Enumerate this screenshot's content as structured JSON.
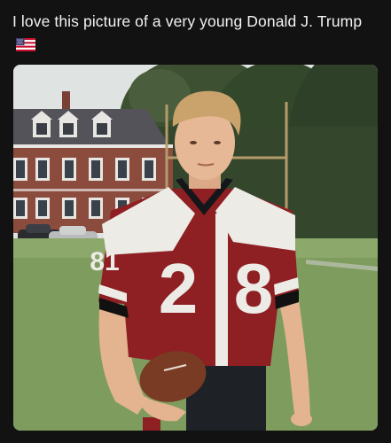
{
  "post": {
    "caption": "I love this picture of a very young Donald J. Trump",
    "caption_emoji": "us-flag-icon"
  },
  "photo": {
    "jersey_number": "28",
    "sleeve_number": "81",
    "colors": {
      "jersey_red": "#8e1f22",
      "jersey_white": "#ecebe6",
      "grass": "#7e9c5e",
      "sky": "#dfe3e2",
      "trees": "#35482c",
      "building_brick": "#8b4c3d",
      "roof": "#54535a",
      "hair": "#c9a26c",
      "skin": "#e6b896",
      "football": "#7a3b24"
    }
  }
}
